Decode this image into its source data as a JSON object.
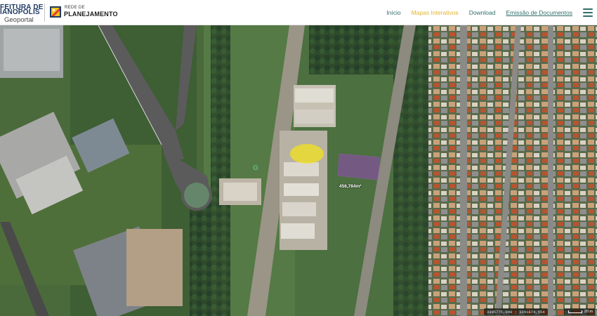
{
  "header": {
    "brand_prefeitura_line1": "FEITURA DE",
    "brand_prefeitura_line2": "IANOPOLIS",
    "brand_geoportal": "Geoportal",
    "brand_rede_top": "REDE DE",
    "brand_rede_main": "PLANEJAMENTO",
    "nav": {
      "inicio": "Início",
      "mapas": "Mapas Interativos",
      "download": "Download",
      "emissao": "Emissão de Documentos"
    },
    "colors": {
      "nav_text": "#2f6f6a",
      "nav_active": "#e1b42a",
      "brand_blue": "#1f3a63"
    },
    "menu_icon": "hamburger-icon"
  },
  "map": {
    "area_label": "456,784m²",
    "watermark": "G",
    "coords_readout": "3395775,049 ; 3241874,554",
    "scale_label": "20 m",
    "highlight_color": "#a63fd4",
    "selection_color": "#f2e21e"
  }
}
